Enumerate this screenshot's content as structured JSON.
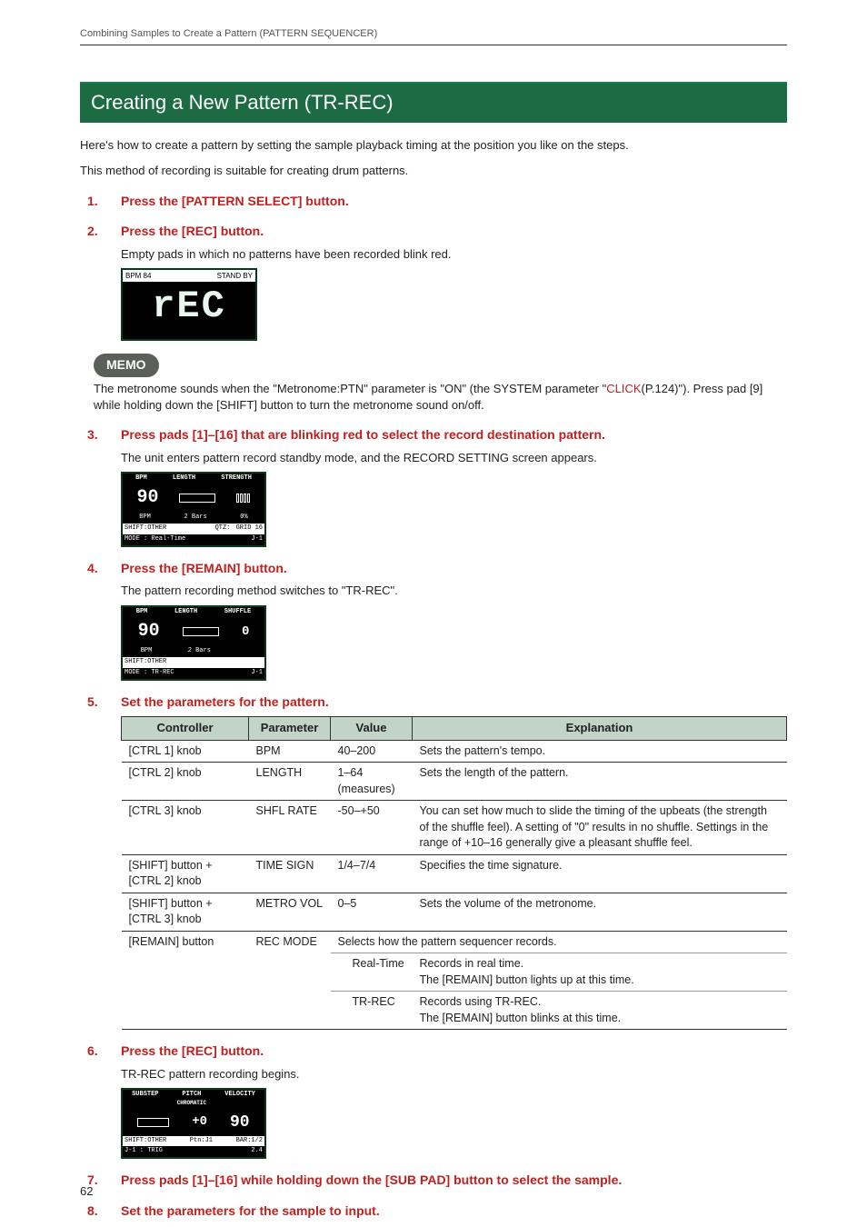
{
  "running_head": "Combining Samples to Create a Pattern (PATTERN SEQUENCER)",
  "section_title": "Creating a New Pattern (TR-REC)",
  "intro1": "Here's how to create a pattern by setting the sample playback timing at the position you like on the steps.",
  "intro2": "This method of recording is suitable for creating drum patterns.",
  "steps": {
    "s1": {
      "num": "1.",
      "text": "Press the [PATTERN SELECT] button."
    },
    "s2": {
      "num": "2.",
      "text": "Press the [REC] button.",
      "body": "Empty pads in which no patterns have been recorded blink red."
    },
    "s3": {
      "num": "3.",
      "text": "Press pads [1]–[16] that are blinking red to select the record destination pattern.",
      "body": "The unit enters pattern record standby mode, and the RECORD SETTING screen appears."
    },
    "s4": {
      "num": "4.",
      "text": "Press the [REMAIN] button.",
      "body": "The pattern recording method switches to \"TR-REC\"."
    },
    "s5": {
      "num": "5.",
      "text": "Set the parameters for the pattern."
    },
    "s6": {
      "num": "6.",
      "text": "Press the [REC] button.",
      "body": "TR-REC pattern recording begins."
    },
    "s7": {
      "num": "7.",
      "text": "Press pads [1]–[16] while holding down the [SUB PAD] button to select the sample."
    },
    "s8": {
      "num": "8.",
      "text": "Set the parameters for the sample to input."
    }
  },
  "lcd1": {
    "top_left": "BPM 84",
    "top_right": "STAND BY",
    "body": "rEC"
  },
  "memo": {
    "label": "MEMO",
    "line1a": "The metronome sounds when the \"Metronome:PTN\" parameter is \"ON\" (the SYSTEM parameter \"",
    "link": "CLICK",
    "line1b": "(P.124)\"). Press pad [9] while holding down the [SHIFT] button to turn the metronome sound on/off."
  },
  "lcd2": {
    "h1": "BPM",
    "h2": "LENGTH",
    "h3": "STRENGTH",
    "big": "90",
    "val": "0%",
    "sub1": "BPM",
    "sub2": "2 Bars",
    "f1": "SHIFT:OTHER",
    "f2": "QTZ:",
    "f3": "GRID 16",
    "b1": "MODE : Real-Time",
    "b2": "J-1"
  },
  "lcd3": {
    "h1": "BPM",
    "h2": "LENGTH",
    "h3": "SHUFFLE",
    "big": "90",
    "val": "0",
    "sub1": "BPM",
    "sub2": "2 Bars",
    "f1": "SHIFT:OTHER",
    "b1": "MODE : TR-REC",
    "b2": "J-1"
  },
  "lcd4": {
    "h1": "SUBSTEP",
    "h2": "PITCH",
    "h2b": "CHROMATIC",
    "h3": "VELOCITY",
    "pitch": "+0",
    "vel": "90",
    "f1": "SHIFT:OTHER",
    "f2": "Ptn:J1",
    "f3": "BAR:1/2",
    "b1": "J-1 : TRIG",
    "b2": "2.4"
  },
  "table": {
    "headers": {
      "controller": "Controller",
      "parameter": "Parameter",
      "value": "Value",
      "explanation": "Explanation"
    },
    "rows": [
      {
        "controller": "[CTRL 1] knob",
        "parameter": "BPM",
        "value": "40–200",
        "explanation": "Sets the pattern's tempo."
      },
      {
        "controller": "[CTRL 2] knob",
        "parameter": "LENGTH",
        "value": "1–64 (measures)",
        "explanation": "Sets the length of the pattern."
      },
      {
        "controller": "[CTRL 3] knob",
        "parameter": "SHFL RATE",
        "value": "-50–+50",
        "explanation": "You can set how much to slide the timing of the upbeats (the strength of the shuffle feel). A setting of \"0\" results in no shuffle. Settings in the range of +10–16 generally give a pleasant shuffle feel."
      },
      {
        "controller": "[SHIFT] button + [CTRL 2] knob",
        "parameter": "TIME SIGN",
        "value": "1/4–7/4",
        "explanation": "Specifies the time signature."
      },
      {
        "controller": "[SHIFT] button + [CTRL 3] knob",
        "parameter": "METRO VOL",
        "value": "0–5",
        "explanation": "Sets the volume of the metronome."
      }
    ],
    "recmode": {
      "controller": "[REMAIN] button",
      "parameter": "REC MODE",
      "explanation_top": "Selects how the pattern sequencer records.",
      "realtime_val": "Real-Time",
      "realtime_exp": "Records in real time.\nThe [REMAIN] button lights up at this time.",
      "trrec_val": "TR-REC",
      "trrec_exp": "Records using TR-REC.\nThe [REMAIN] button blinks at this time."
    }
  },
  "page_num": "62"
}
